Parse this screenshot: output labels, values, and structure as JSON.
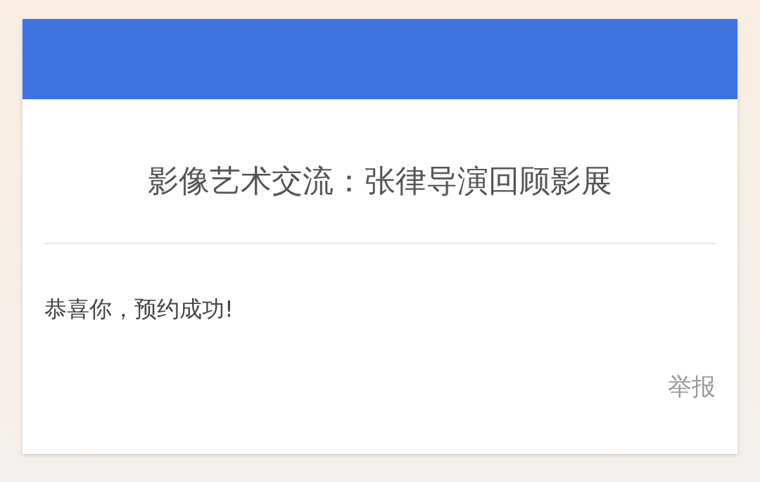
{
  "card": {
    "title": "影像艺术交流：张律导演回顾影展",
    "message": "恭喜你，预约成功!",
    "report_link": "举报"
  }
}
